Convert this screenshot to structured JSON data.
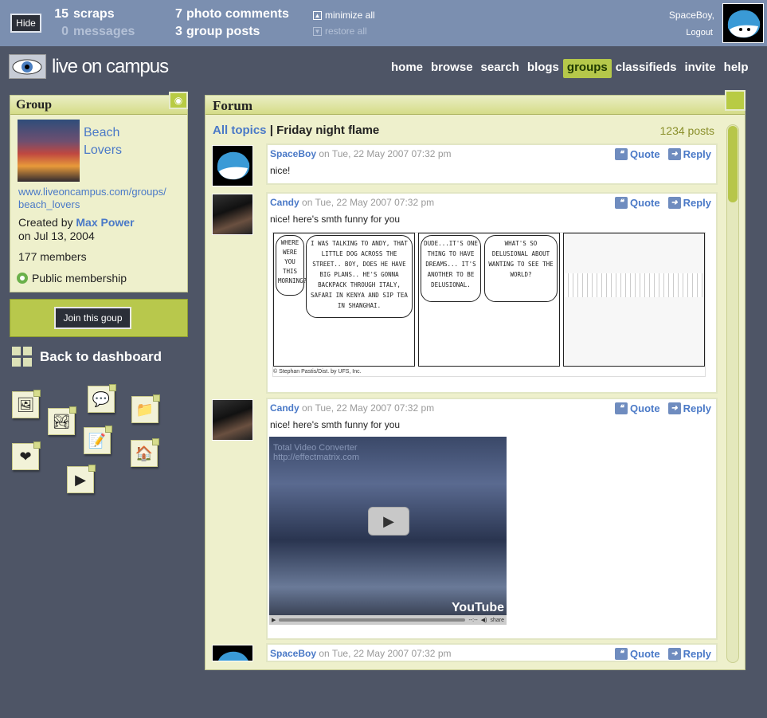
{
  "topbar": {
    "hide_label": "Hide",
    "scraps_count": "15",
    "scraps_label": "scraps",
    "messages_count": "0",
    "messages_label": "messages",
    "photo_comments_count": "7",
    "photo_comments_label": "photo comments",
    "group_posts_count": "3",
    "group_posts_label": "group posts",
    "minimize_all": "minimize all",
    "restore_all": "restore all",
    "username": "SpaceBoy,",
    "logout": "Logout"
  },
  "brand": {
    "name": "live on campus"
  },
  "nav": {
    "items": [
      "home",
      "browse",
      "search",
      "blogs",
      "groups",
      "classifieds",
      "invite",
      "help"
    ],
    "active": "groups"
  },
  "group": {
    "heading": "Group",
    "name_line1": "Beach",
    "name_line2": "Lovers",
    "url_line1": "www.liveoncampus.com/groups/",
    "url_line2": "beach_lovers",
    "created_by_label": "Created by",
    "creator": "Max Power",
    "created_on": "on Jul 13, 2004",
    "members": "177 members",
    "membership": "Public membership"
  },
  "join_button": "Join this goup",
  "back_to_dashboard": "Back to dashboard",
  "widgets": [
    "photo-widget-icon",
    "gallery-widget-icon",
    "chat-widget-icon",
    "folder-widget-icon",
    "heart-widget-icon",
    "notes-widget-icon",
    "house-widget-icon",
    "media-widget-icon"
  ],
  "forum": {
    "heading": "Forum",
    "all_topics": "All topics",
    "separator": "|",
    "topic": "Friday night flame",
    "post_count": "1234 posts",
    "quote_label": "Quote",
    "reply_label": "Reply",
    "posts": [
      {
        "author": "SpaceBoy",
        "date": "on Tue, 22 May 2007 07:32 pm",
        "text": "nice!"
      },
      {
        "author": "Candy",
        "date": "on Tue, 22 May 2007 07:32 pm",
        "text": "nice! here's smth funny for you"
      },
      {
        "author": "Candy",
        "date": " on  Tue, 22 May 2007 07:32 pm",
        "text": "nice! here's smth funny for you"
      },
      {
        "author": "SpaceBoy",
        "date": "on Tue, 22 May 2007 07:32 pm",
        "text": ""
      }
    ]
  },
  "comic": {
    "panel1_bubble1": "Where were you this morning?",
    "panel1_bubble2": "I was talking to Andy, that little dog across the street.. Boy, does he have big plans.. He's gonna backpack through Italy, safari in Kenya and sip tea in Shanghai.",
    "panel2_bubble1": "Dude...It's one thing to have dreams... It's another to be delusional.",
    "panel2_bubble2": "What's so delusional about wanting to see the world?",
    "credit": "© Stephan Pastis/Dist. by UFS, Inc."
  },
  "video": {
    "title_line1": "Total Video Converter",
    "title_line2": "http://effectmatrix.com",
    "logo": "YouTube",
    "time": "--:--",
    "share": "share"
  }
}
